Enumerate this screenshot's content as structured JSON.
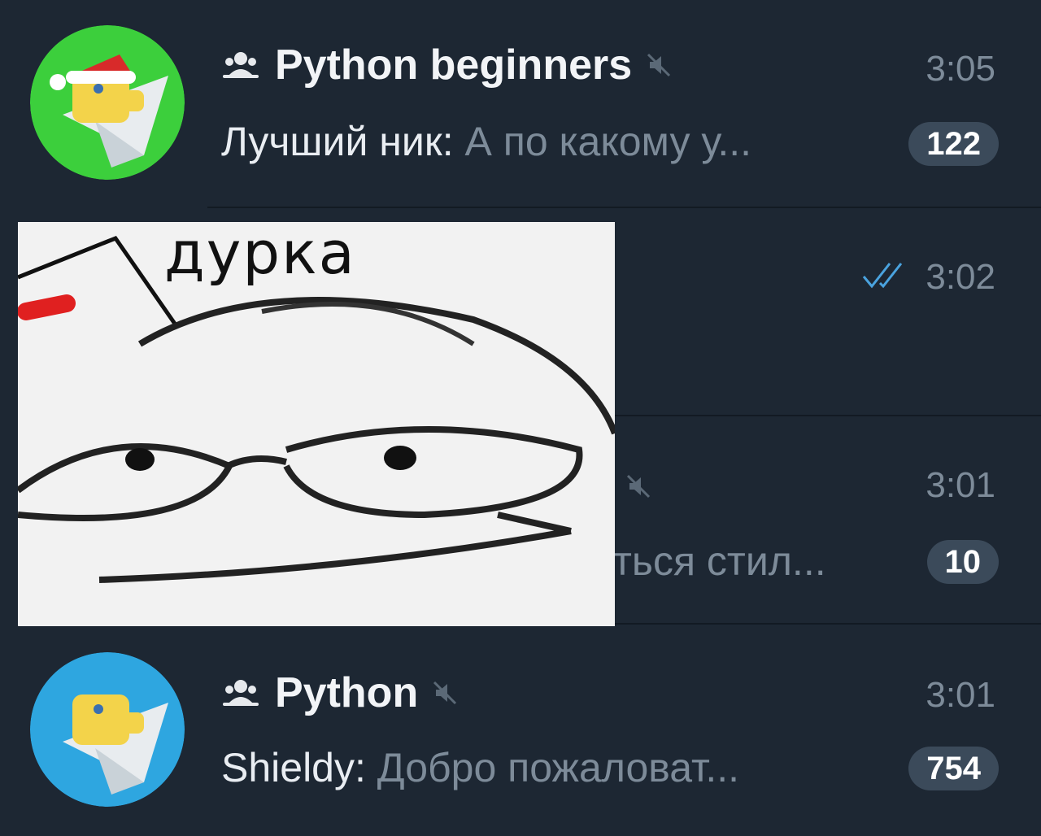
{
  "chats": [
    {
      "title": "Python beginners",
      "time": "3:05",
      "sender": "Лучший ник:",
      "message": "А по какому у...",
      "unread": "122",
      "is_group": true,
      "muted": true,
      "avatar_icon": "python-telegram-santa-icon",
      "avatar_color": "#3ccf3c"
    },
    {
      "title": "",
      "time": "3:02",
      "read_status_icon": "double-check-icon"
    },
    {
      "title": "",
      "time": "3:01",
      "message": "ться стил...",
      "unread": "10",
      "muted": true
    },
    {
      "title": "Python",
      "time": "3:01",
      "sender": "Shieldy:",
      "message": "Добро пожаловат...",
      "unread": "754",
      "is_group": true,
      "muted": true,
      "avatar_icon": "python-telegram-icon",
      "avatar_color": "#2ea6e0"
    }
  ],
  "overlay": {
    "caption": "дурка",
    "icon": "meme-face-drawing"
  },
  "colors": {
    "background": "#1d2733",
    "divider": "#121a23",
    "badge": "#3b4a5a",
    "muted_text": "#7d8b99",
    "read_check": "#4aa3df"
  }
}
